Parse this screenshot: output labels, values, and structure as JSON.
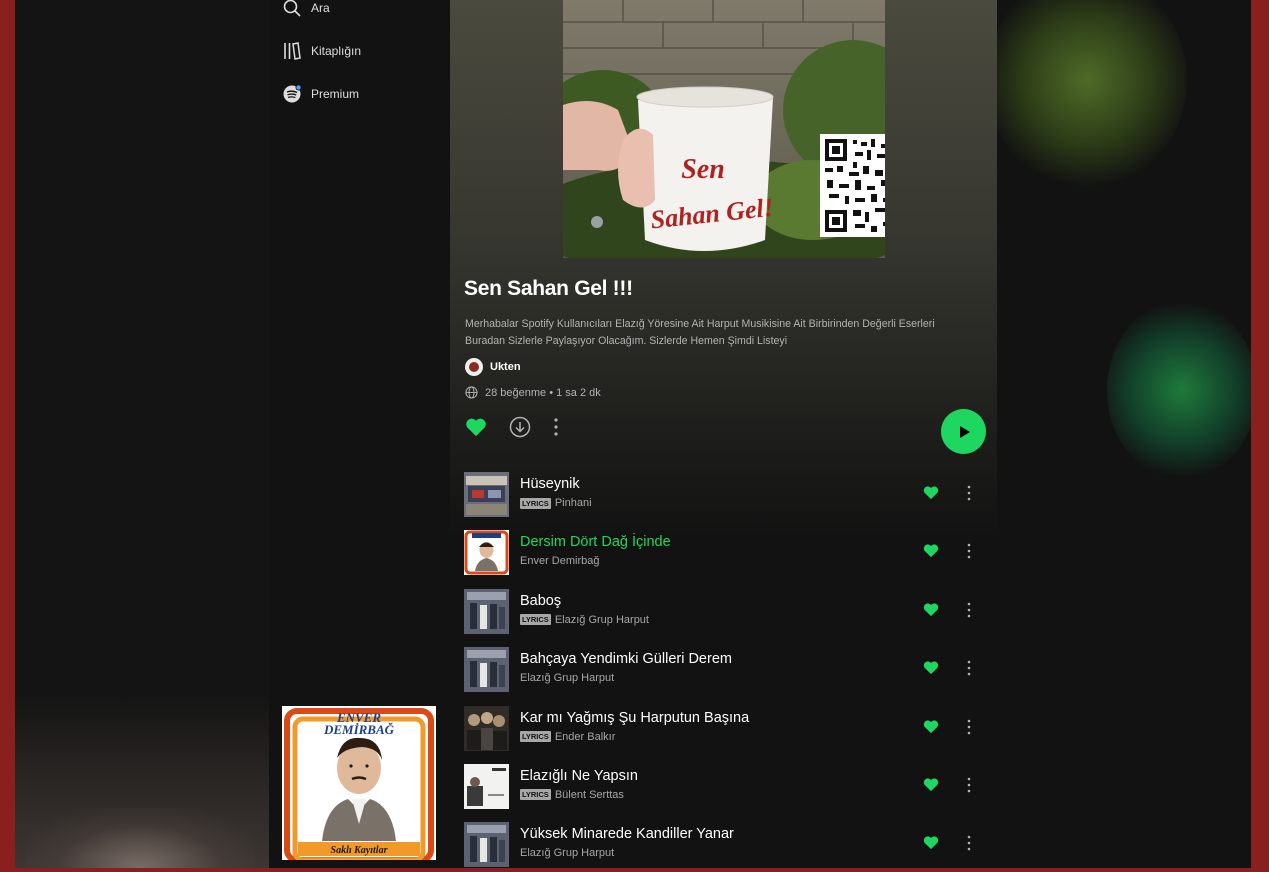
{
  "nav": {
    "search_label": "Ara",
    "library_label": "Kitaplığın",
    "premium_label": "Premium"
  },
  "now_playing_art": {
    "line1": "ENVER",
    "line2": "DEMİRBAĞ",
    "footer": "Saklı Kayıtlar"
  },
  "cover_art": {
    "line1": "Sen",
    "line2": "Sahan Gel!"
  },
  "playlist": {
    "title": "Sen Sahan Gel !!!",
    "description": "Merhabalar Spotify Kullanıcıları Elazığ Yöresine Ait Harput Musikisine Ait Birbirinden Değerli Eserleri Buradan Sizlerle Paylaşıyor Olacağım. Sizlerde Hemen Şimdi Listeyi",
    "owner": "Ukten",
    "meta": "28 beğenme • 1 sa 2 dk"
  },
  "tracks": [
    {
      "title": "Hüseynik",
      "artist": "Pinhani",
      "lyrics": "LYRICS",
      "active": false
    },
    {
      "title": "Dersim Dört Dağ İçinde",
      "artist": "Enver Demirbağ",
      "lyrics": "",
      "active": true
    },
    {
      "title": "Baboş",
      "artist": "Elazığ Grup Harput",
      "lyrics": "LYRICS",
      "active": false
    },
    {
      "title": "Bahçaya Yendimki Gülleri Derem",
      "artist": "Elazığ Grup Harput",
      "lyrics": "",
      "active": false
    },
    {
      "title": "Kar mı Yağmış Şu Harputun Başına",
      "artist": "Ender Balkır",
      "lyrics": "LYRICS",
      "active": false
    },
    {
      "title": "Elazığlı Ne Yapsın",
      "artist": "Bülent Serttas",
      "lyrics": "LYRICS",
      "active": false
    },
    {
      "title": "Yüksek Minarede Kandiller Yanar",
      "artist": "Elazığ Grup Harput",
      "lyrics": "",
      "active": false
    }
  ],
  "colors": {
    "accent": "#1ed760",
    "frame": "#8a1f1f",
    "background": "#121212"
  }
}
